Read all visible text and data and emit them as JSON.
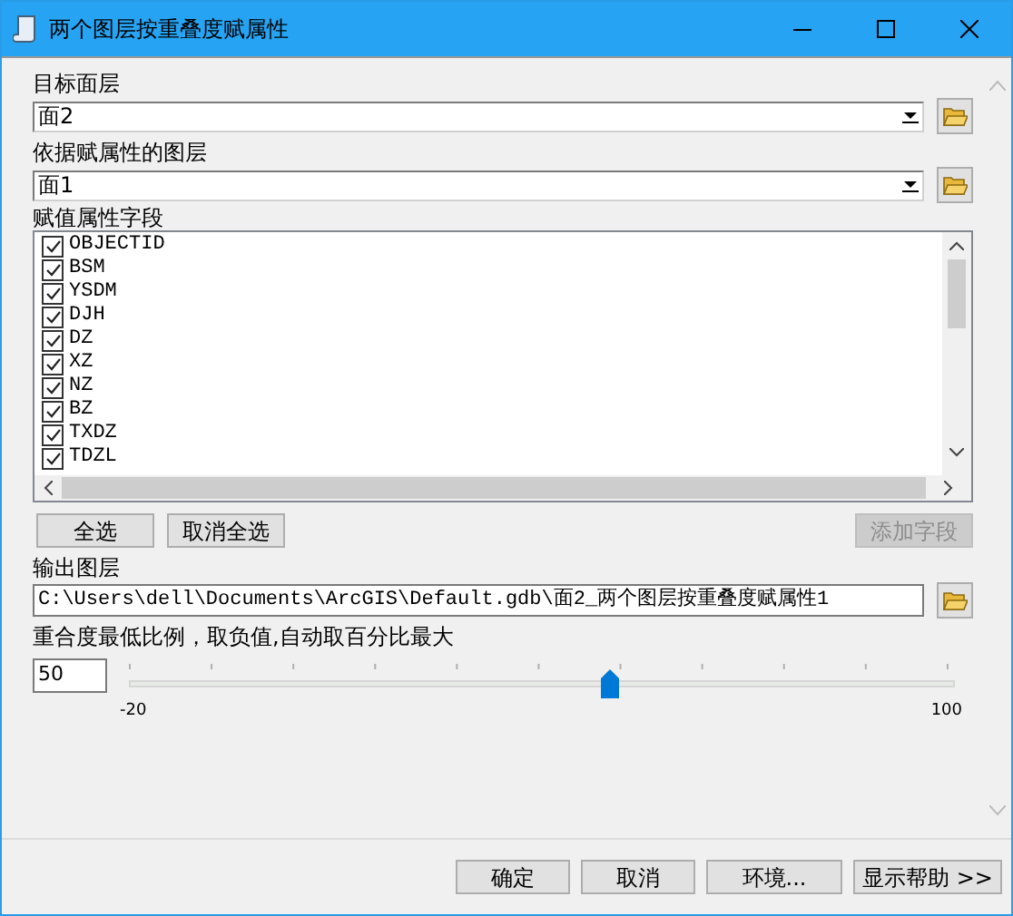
{
  "window": {
    "title": "两个图层按重叠度赋属性"
  },
  "target_layer": {
    "label": "目标面层",
    "value": "面2"
  },
  "source_layer": {
    "label": "依据赋属性的图层",
    "value": "面1"
  },
  "fields": {
    "label": "赋值属性字段",
    "items": [
      {
        "name": "OBJECTID",
        "checked": true
      },
      {
        "name": "BSM",
        "checked": true
      },
      {
        "name": "YSDM",
        "checked": true
      },
      {
        "name": "DJH",
        "checked": true
      },
      {
        "name": "DZ",
        "checked": true
      },
      {
        "name": "XZ",
        "checked": true
      },
      {
        "name": "NZ",
        "checked": true
      },
      {
        "name": "BZ",
        "checked": true
      },
      {
        "name": "TXDZ",
        "checked": true
      },
      {
        "name": "TDZL",
        "checked": true
      }
    ]
  },
  "field_buttons": [
    {
      "label": "全选",
      "disabled": false
    },
    {
      "label": "取消全选",
      "disabled": false
    },
    {
      "label": "添加字段",
      "disabled": true
    }
  ],
  "output_layer": {
    "label": "输出图层",
    "value": "C:\\Users\\dell\\Documents\\ArcGIS\\Default.gdb\\面2_两个图层按重叠度赋属性1"
  },
  "overlap": {
    "label": "重合度最低比例，取负值,自动取百分比最大",
    "value": "50",
    "level": 0.583,
    "min_label": "-20",
    "max_label": "100"
  },
  "footer_buttons": [
    "确定",
    "取消",
    "环境...",
    "显示帮助 >>"
  ]
}
